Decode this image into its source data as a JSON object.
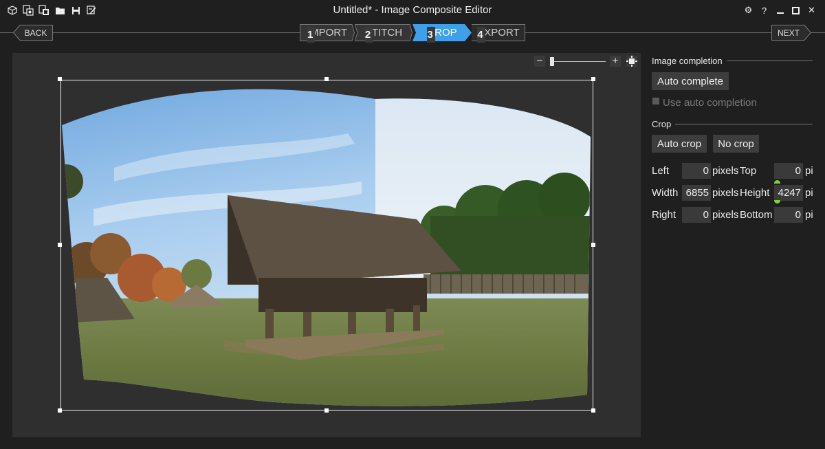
{
  "window": {
    "title": "Untitled* - Image Composite Editor"
  },
  "quick_access": [
    "new-project-icon",
    "new-panorama-icon",
    "new-video-panorama-icon",
    "open-folder-icon",
    "save-icon",
    "save-as-icon"
  ],
  "window_controls": {
    "settings": "⚙",
    "help": "?",
    "minimize": "‒",
    "maximize": "☐",
    "close": "✕"
  },
  "nav": {
    "back": "BACK",
    "next": "NEXT"
  },
  "steps": [
    {
      "num": "1",
      "label": "IMPORT"
    },
    {
      "num": "2",
      "label": "STITCH"
    },
    {
      "num": "3",
      "label": "CROP"
    },
    {
      "num": "4",
      "label": "EXPORT"
    }
  ],
  "zoom": {
    "minus": "−",
    "plus": "+",
    "level": 0.0
  },
  "panel": {
    "image_completion": {
      "header": "Image completion",
      "auto_complete": "Auto complete",
      "use_auto_completion": "Use auto completion"
    },
    "crop": {
      "header": "Crop",
      "auto_crop": "Auto crop",
      "no_crop": "No crop",
      "left_label": "Left",
      "left_value": "0",
      "left_unit": "pixels",
      "top_label": "Top",
      "top_value": "0",
      "top_unit": "pi",
      "width_label": "Width",
      "width_value": "6855",
      "width_unit": "pixels",
      "height_label": "Height",
      "height_value": "4247",
      "height_unit": "pi",
      "right_label": "Right",
      "right_value": "0",
      "right_unit": "pixels",
      "bottom_label": "Bottom",
      "bottom_value": "0",
      "bottom_unit": "pi"
    }
  },
  "colors": {
    "accent": "#3da0e8",
    "background": "#1f1f1f",
    "canvas": "#2f2f2f",
    "lock_indicator": "#8acb2f"
  }
}
